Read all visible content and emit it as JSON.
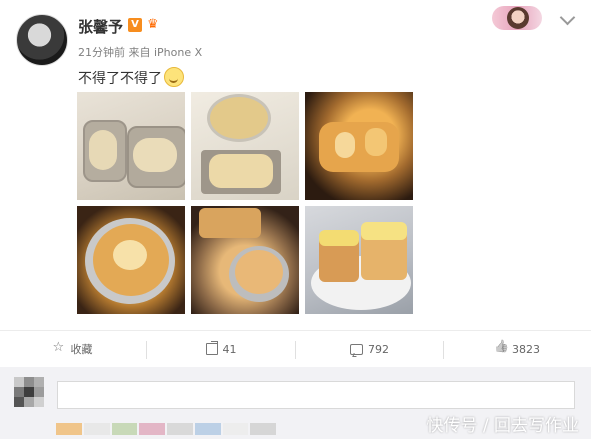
{
  "post": {
    "username": "张馨予",
    "verified_badge": "V",
    "meta": "21分钟前 来自 iPhone X",
    "content_text": "不得了不得了",
    "content_emoji": "smile-emoji-icon"
  },
  "photos": [
    {
      "name": "photo-dough-in-pans"
    },
    {
      "name": "photo-dough-with-sesame"
    },
    {
      "name": "photo-baked-bread-oven"
    },
    {
      "name": "photo-bread-foil-top"
    },
    {
      "name": "photo-bread-foil-side"
    },
    {
      "name": "photo-bread-on-plate"
    }
  ],
  "actions": {
    "collect_label": "收藏",
    "share_count": "41",
    "comment_count": "792",
    "like_count": "3823"
  },
  "watermark": "快传号 / 回去写作业",
  "colors": {
    "accent_orange": "#f78d1e",
    "text_gray": "#808080"
  }
}
